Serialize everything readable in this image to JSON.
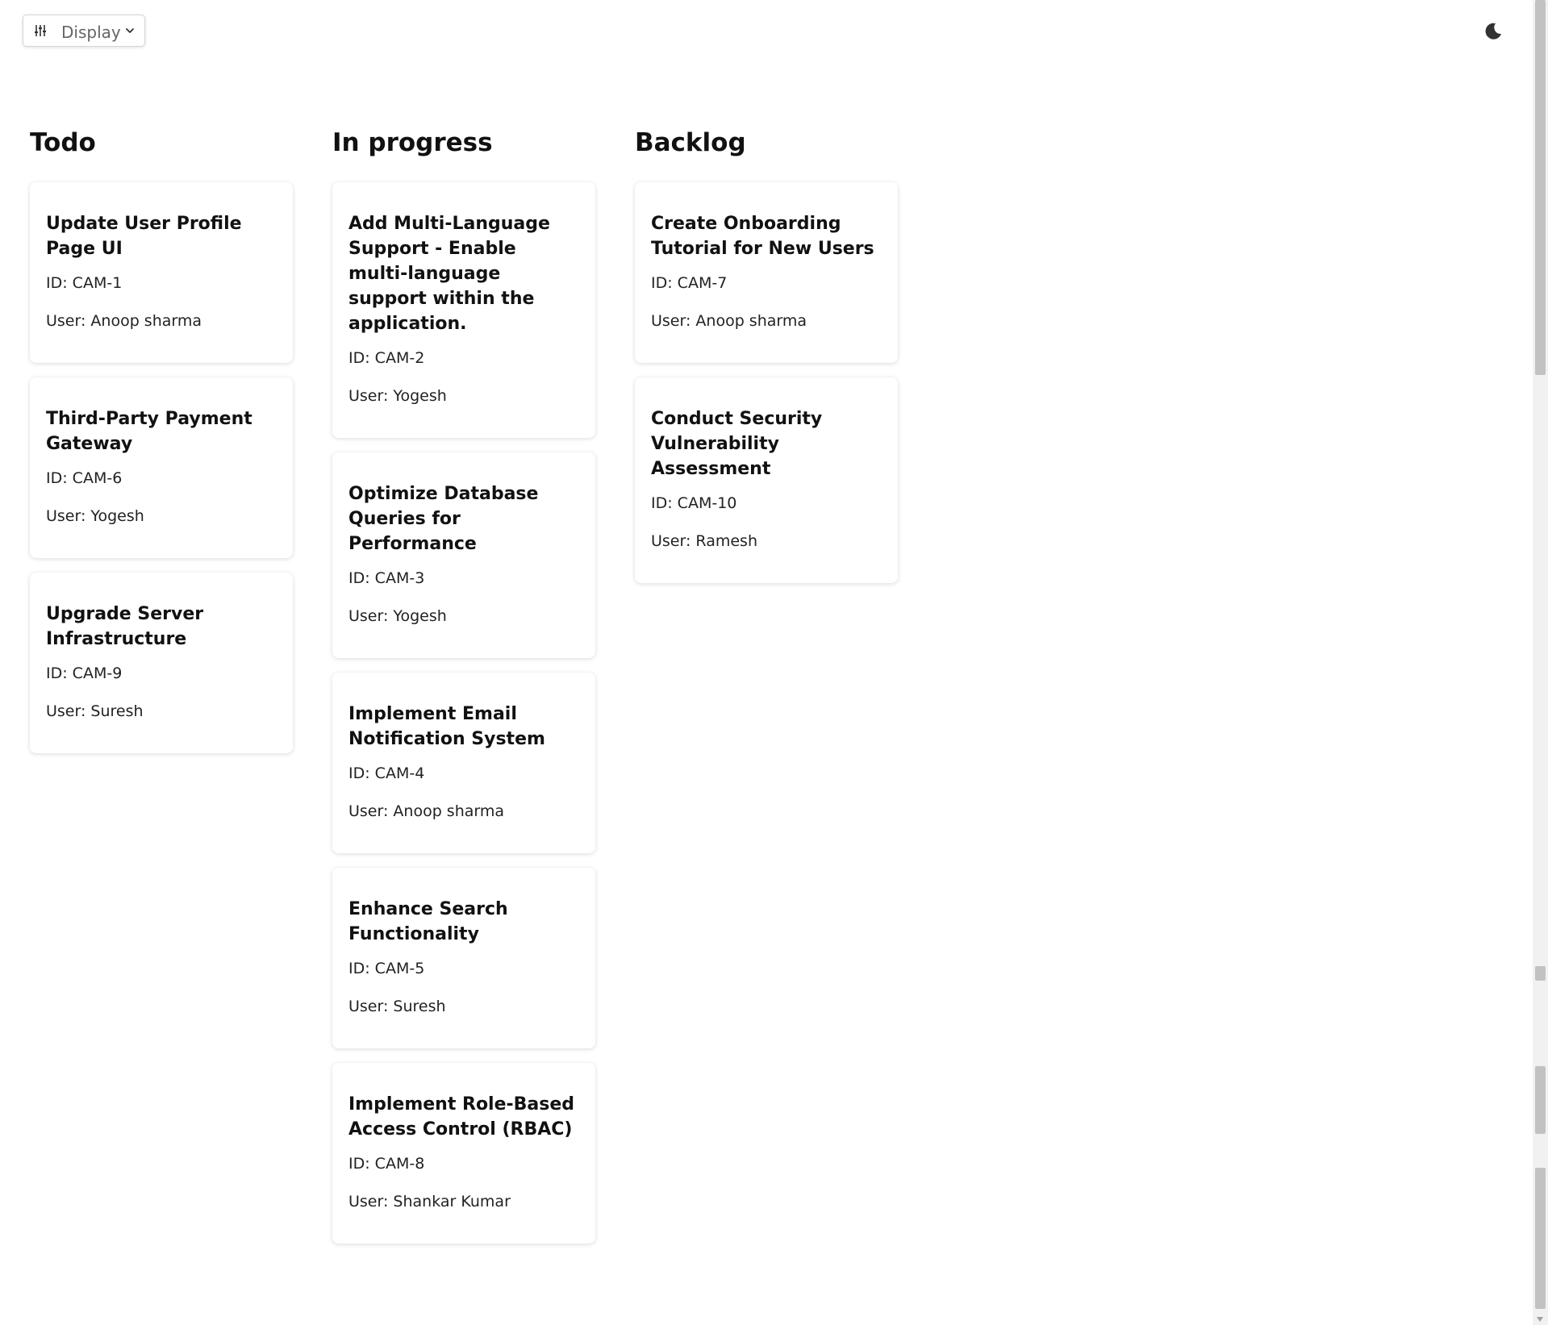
{
  "toolbar": {
    "display_label": "Display",
    "theme_icon": "moon-icon"
  },
  "columns": [
    {
      "title": "Todo",
      "cards": [
        {
          "title": "Update User Profile Page UI",
          "id": "ID: CAM-1",
          "user": "User: Anoop sharma"
        },
        {
          "title": "Third-Party Payment Gateway",
          "id": "ID: CAM-6",
          "user": "User: Yogesh"
        },
        {
          "title": "Upgrade Server Infrastructure",
          "id": "ID: CAM-9",
          "user": "User: Suresh"
        }
      ]
    },
    {
      "title": "In progress",
      "cards": [
        {
          "title": "Add Multi-Language Support - Enable multi-language support within the application.",
          "id": "ID: CAM-2",
          "user": "User: Yogesh"
        },
        {
          "title": "Optimize Database Queries for Performance",
          "id": "ID: CAM-3",
          "user": "User: Yogesh"
        },
        {
          "title": "Implement Email Notification System",
          "id": "ID: CAM-4",
          "user": "User: Anoop sharma"
        },
        {
          "title": "Enhance Search Functionality",
          "id": "ID: CAM-5",
          "user": "User: Suresh"
        },
        {
          "title": "Implement Role-Based Access Control (RBAC)",
          "id": "ID: CAM-8",
          "user": "User: Shankar Kumar"
        }
      ]
    },
    {
      "title": "Backlog",
      "cards": [
        {
          "title": "Create Onboarding Tutorial for New Users",
          "id": "ID: CAM-7",
          "user": "User: Anoop sharma"
        },
        {
          "title": "Conduct Security Vulnerability Assessment",
          "id": "ID: CAM-10",
          "user": "User: Ramesh"
        }
      ]
    }
  ]
}
